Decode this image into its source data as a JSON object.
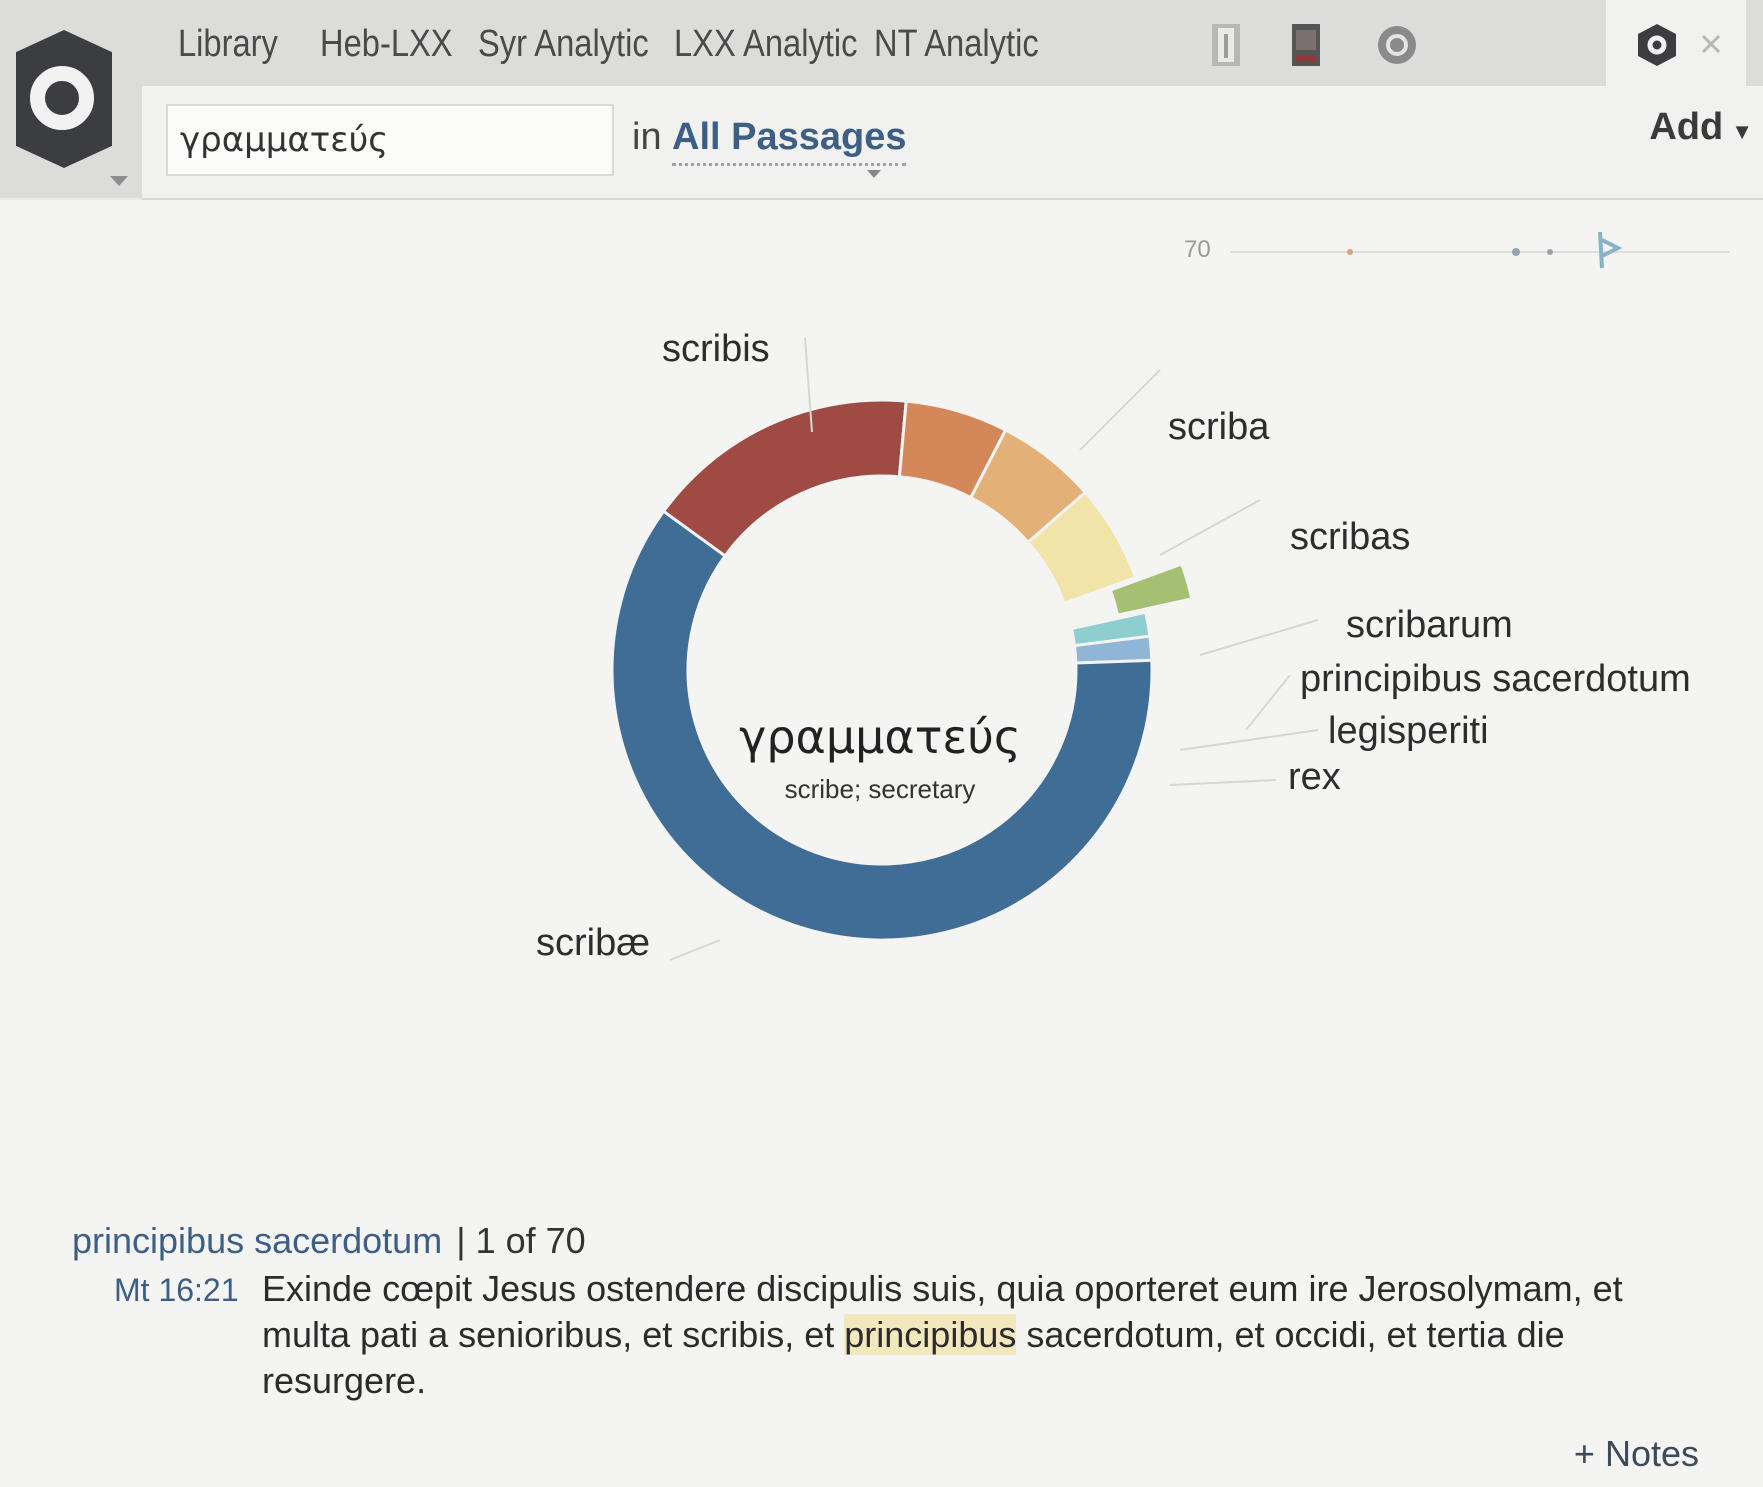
{
  "tabs": [
    "Library",
    "Heb-LXX",
    "Syr Analytic",
    "LXX Analytic",
    "NT Analytic"
  ],
  "search": {
    "query": "γραμματεύς",
    "in_label": "in",
    "scope": "All Passages"
  },
  "add_label": "Add",
  "timeline": {
    "count": "70"
  },
  "center": {
    "lemma": "γραμματεύς",
    "gloss": "scribe; secretary"
  },
  "colors": {
    "accent_link": "#3d5f86",
    "highlight": "#f3e7bd"
  },
  "chart_data": {
    "type": "pie",
    "donut": true,
    "title": "",
    "unit": "occurrences",
    "categories": [
      "scribis",
      "scriba",
      "scribas",
      "scribarum",
      "principibus sacerdotum",
      "legisperiti",
      "rex",
      "scribæ"
    ],
    "values": [
      11.5,
      4.3,
      4.2,
      4.1,
      1.5,
      1.0,
      1.0,
      42.4
    ],
    "colors": [
      "#a04a44",
      "#d4885a",
      "#e3b078",
      "#f1e4a9",
      "#a5bf73",
      "#8ccfce",
      "#8fb6d6",
      "#3f6d96"
    ],
    "legend": "labels on slices"
  },
  "result": {
    "term": "principibus sacerdotum",
    "separator": "|",
    "count": "1 of 70",
    "ref": "Mt 16:21",
    "text_before": "Exinde cœpit Jesus ostendere discipulis suis, quia oporteret eum ire Jerosolymam, et multa pati a senioribus, et scribis, et ",
    "highlight": "principibus",
    "text_after": " sacerdotum, et occidi, et tertia die resurgere."
  },
  "notes_label": "+ Notes"
}
